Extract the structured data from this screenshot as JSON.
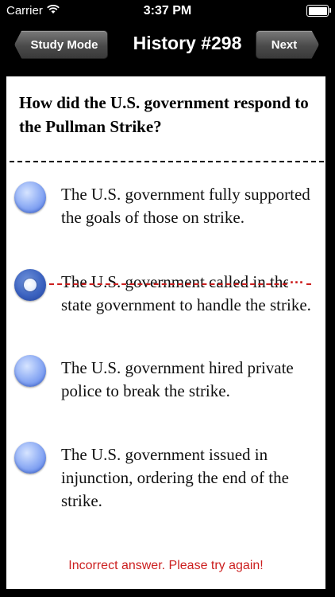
{
  "status_bar": {
    "carrier": "Carrier",
    "wifi_icon": "wifi-icon",
    "time": "3:37 PM",
    "battery_icon": "battery-full-icon"
  },
  "nav": {
    "back_label": "Study Mode",
    "title": "History #298",
    "next_label": "Next"
  },
  "quiz": {
    "question": "How did the U.S. government respond to the Pullman Strike?",
    "options": [
      {
        "text": "The U.S. government fully supported the goals of those on strike.",
        "selected": false,
        "struck": false
      },
      {
        "text": "The U.S. government called in the state government to handle the strike.",
        "selected": true,
        "struck": true
      },
      {
        "text": "The U.S. government hired private police to break the strike.",
        "selected": false,
        "struck": false
      },
      {
        "text": "The U.S. government issued in injunction, ordering the end of the strike.",
        "selected": false,
        "struck": false
      }
    ],
    "strike_trail": "...",
    "feedback": "Incorrect answer. Please try again!"
  },
  "colors": {
    "background": "#000000",
    "card": "#ffffff",
    "error": "#cc1f1f",
    "radio": "#6f93ee"
  }
}
